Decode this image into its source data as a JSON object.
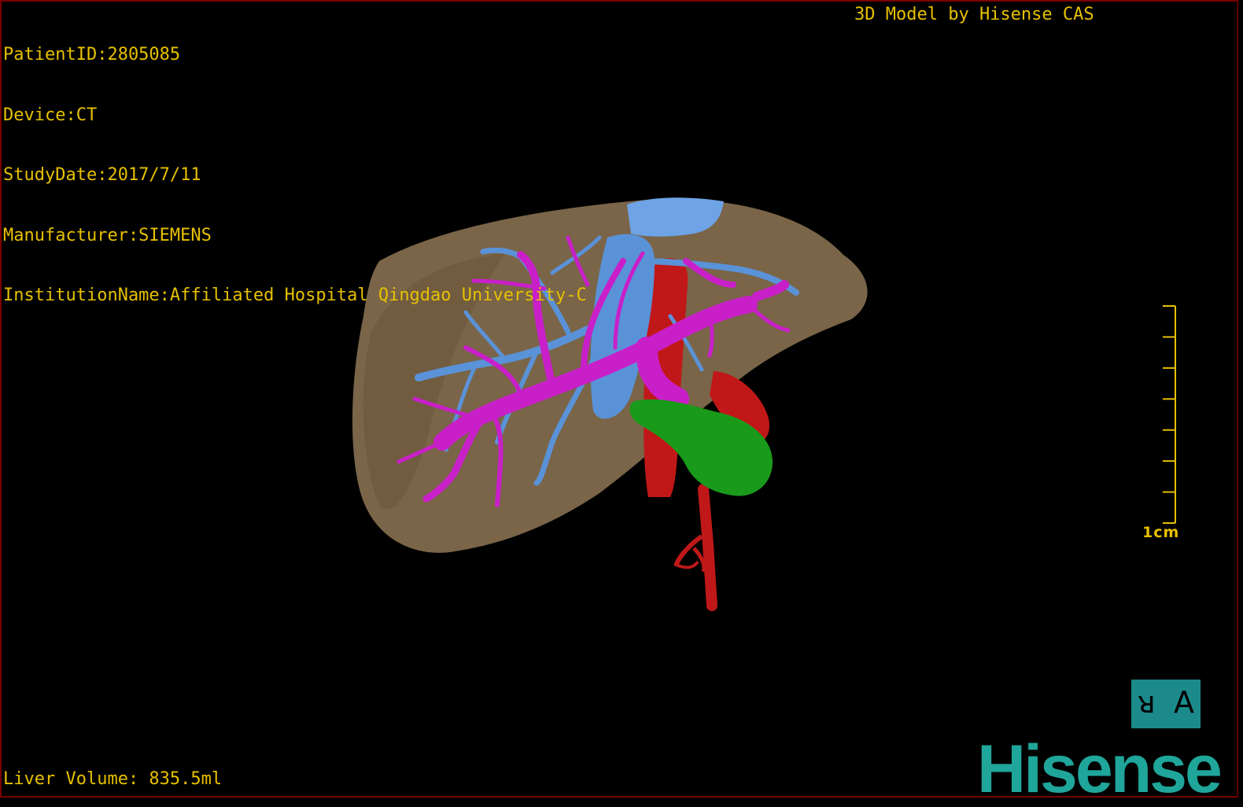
{
  "patient_info": [
    "PatientID:2805085",
    "Device:CT",
    "StudyDate:2017/7/11",
    "Manufacturer:SIEMENS",
    "InstitutionName:Affiliated Hospital Qingdao University-C"
  ],
  "credit": "3D Model by Hisense CAS",
  "liver_volume": "Liver Volume: 835.5ml",
  "scale": {
    "label": "1cm",
    "ticks": 8
  },
  "orientation": {
    "left_glyph": "ᴚ",
    "right_glyph": "A"
  },
  "brand": "Hisense",
  "colors": {
    "text": "#e6c000",
    "liver": "#7a6548",
    "hepatic_vein": "#5a92d8",
    "portal_vein": "#c81fc8",
    "artery": "#c01818",
    "gallbladder": "#1a9a1a",
    "brand": "#1fa59a",
    "orientation_bg": "#1c8a8a"
  }
}
